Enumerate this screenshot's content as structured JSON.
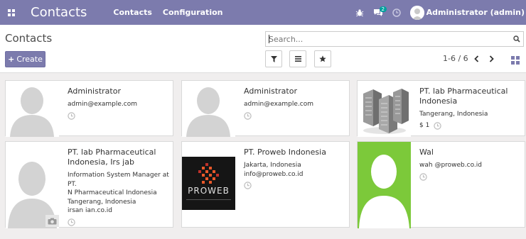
{
  "navbar": {
    "app_title": "Contacts",
    "menu": [
      "Contacts",
      "Configuration"
    ],
    "messages_count": "2",
    "user_name": "Administrator (admin)",
    "color": "#7c7bad"
  },
  "control_panel": {
    "breadcrumb": "Contacts",
    "create_label": "Create",
    "search_placeholder": "Search...",
    "pager": "1-6 / 6"
  },
  "cards": [
    {
      "name": "Administrator",
      "lines": [
        "admin@example.com"
      ]
    },
    {
      "name": "Administrator",
      "lines": [
        "admin@example.com"
      ]
    },
    {
      "name_line1": "PT.    lab Pharmaceutical",
      "name_line2": "Indonesia",
      "lines": [
        "Tangerang, Indonesia"
      ],
      "money": "$ 1"
    },
    {
      "name_line1": "PT.     lab Pharmaceutical",
      "name_line2": "Indonesia, Irs         jab",
      "lines": [
        "Information System Manager at PT.",
        "N         Pharmaceutical Indonesia",
        "Tangerang, Indonesia",
        "irsan                 ian.co.id"
      ]
    },
    {
      "name": "PT. Proweb Indonesia",
      "lines": [
        "Jakarta, Indonesia",
        "info@proweb.co.id"
      ],
      "logo_text": "PROWEB"
    },
    {
      "name": "Wal",
      "lines": [
        "wah          @proweb.co.id"
      ]
    }
  ]
}
